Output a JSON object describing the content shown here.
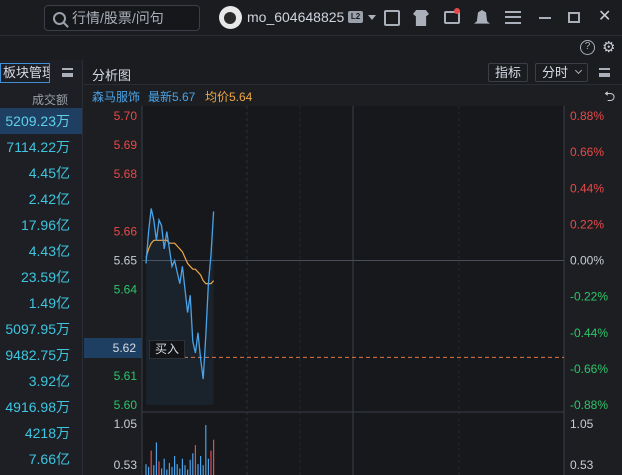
{
  "topbar": {
    "search_placeholder": "行情/股票/问句",
    "username": "mo_604648825",
    "level_badge": "L2"
  },
  "toolbar2": {
    "help_glyph": "?",
    "gear_glyph": "⚙"
  },
  "left_panel": {
    "sector_button": "板块管理",
    "column_header": "成交额",
    "rows": [
      {
        "value": "5209.23万",
        "selected": true
      },
      {
        "value": "7114.22万"
      },
      {
        "value": "4.45亿"
      },
      {
        "value": "2.42亿"
      },
      {
        "value": "17.96亿"
      },
      {
        "value": "4.43亿"
      },
      {
        "value": "23.59亿"
      },
      {
        "value": "1.49亿"
      },
      {
        "value": "5097.95万"
      },
      {
        "value": "9482.75万"
      },
      {
        "value": "3.92亿"
      },
      {
        "value": "4916.98万"
      },
      {
        "value": "4218万"
      },
      {
        "value": "7.66亿"
      }
    ]
  },
  "chart_panel": {
    "title": "分析图",
    "indicator_button": "指标",
    "timeshare_button": "分时",
    "stock_name": "森马服饰",
    "latest": "最新5.67",
    "avg_price": "均价5.64",
    "buy_tag": "买入",
    "current_price_tag": "5.62"
  },
  "colors": {
    "up": "#e84a4a",
    "down": "#2ec46a",
    "neutral": "#c8ccd4",
    "price_line": "#4aa3e8",
    "avg_line": "#f0a844",
    "accent": "#3e8fd8"
  },
  "chart_data": {
    "type": "line",
    "price_ticks": [
      "5.70",
      "5.69",
      "5.68",
      "5.66",
      "5.65",
      "5.64",
      "5.62",
      "5.61",
      "5.60"
    ],
    "pct_ticks": [
      "0.88%",
      "0.66%",
      "0.44%",
      "0.22%",
      "0.00%",
      "-0.22%",
      "-0.44%",
      "-0.66%",
      "-0.88%"
    ],
    "ylim": [
      5.6,
      5.7
    ],
    "prev_close": 5.65,
    "volume_ticks": [
      "1.05",
      "0.53"
    ],
    "series": [
      {
        "values": [
          5.649,
          5.66,
          5.668,
          5.664,
          5.657,
          5.664,
          5.662,
          5.654,
          5.66,
          5.654,
          5.648,
          5.65,
          5.646,
          5.642,
          5.648,
          5.64,
          5.632,
          5.638,
          5.622,
          5.618,
          5.625,
          5.616,
          5.609,
          5.624,
          5.642,
          5.652,
          5.667
        ]
      },
      {
        "values": [
          5.651,
          5.654,
          5.656,
          5.657,
          5.657,
          5.657,
          5.657,
          5.657,
          5.657,
          5.656,
          5.656,
          5.656,
          5.655,
          5.654,
          5.653,
          5.651,
          5.649,
          5.648,
          5.647,
          5.647,
          5.646,
          5.645,
          5.643,
          5.642,
          5.642,
          5.642,
          5.643
        ]
      }
    ],
    "volume": [
      0.2,
      0.15,
      0.45,
      0.18,
      0.6,
      0.25,
      0.12,
      0.3,
      0.1,
      0.22,
      0.15,
      0.35,
      0.2,
      0.12,
      0.3,
      0.18,
      0.1,
      0.28,
      0.4,
      0.55,
      0.2,
      0.35,
      0.18,
      0.92,
      0.3,
      0.45,
      0.65
    ],
    "volume_up": [
      0,
      0,
      1,
      0,
      0,
      1,
      0,
      0,
      0,
      0,
      0,
      0,
      0,
      0,
      0,
      0,
      0,
      0,
      0,
      1,
      0,
      0,
      0,
      0,
      0,
      1,
      1
    ]
  }
}
